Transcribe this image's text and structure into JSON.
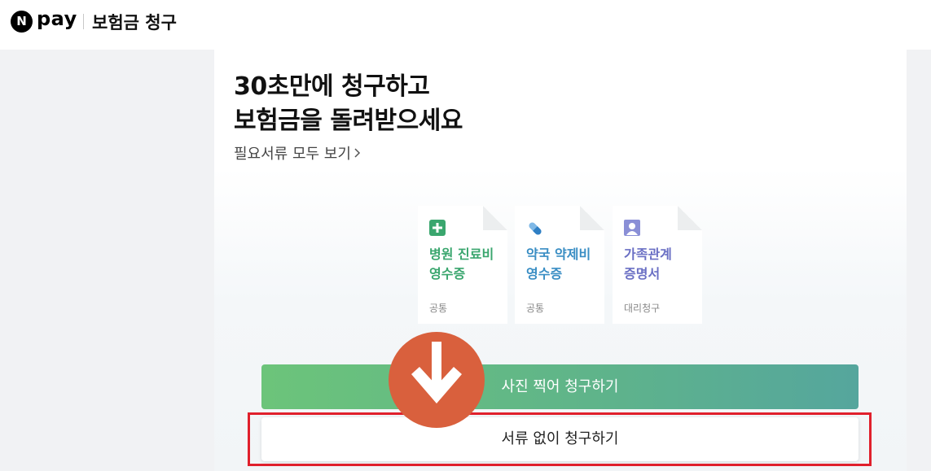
{
  "header": {
    "logo_mark": "N",
    "logo_text": "pay",
    "title": "보험금 청구"
  },
  "main": {
    "headline_line1": "30초만에 청구하고",
    "headline_line2": "보험금을 돌려받으세요",
    "docs_link": "필요서류 모두 보기"
  },
  "cards": [
    {
      "icon": "medical-plus-icon",
      "title_line1": "병원 진료비",
      "title_line2": "영수증",
      "tag": "공통",
      "color": "#3aa66e"
    },
    {
      "icon": "pill-icon",
      "title_line1": "약국 약제비",
      "title_line2": "영수증",
      "tag": "공통",
      "color": "#3a8ec4"
    },
    {
      "icon": "person-icon",
      "title_line1": "가족관계",
      "title_line2": "증명서",
      "tag": "대리청구",
      "color": "#6a6fc4"
    }
  ],
  "buttons": {
    "photo_claim": "사진 찍어 청구하기",
    "no_doc_claim": "서류 없이 청구하기"
  },
  "annotation": {
    "arrow_color": "#d9603d",
    "highlight_color": "#e0202c"
  }
}
